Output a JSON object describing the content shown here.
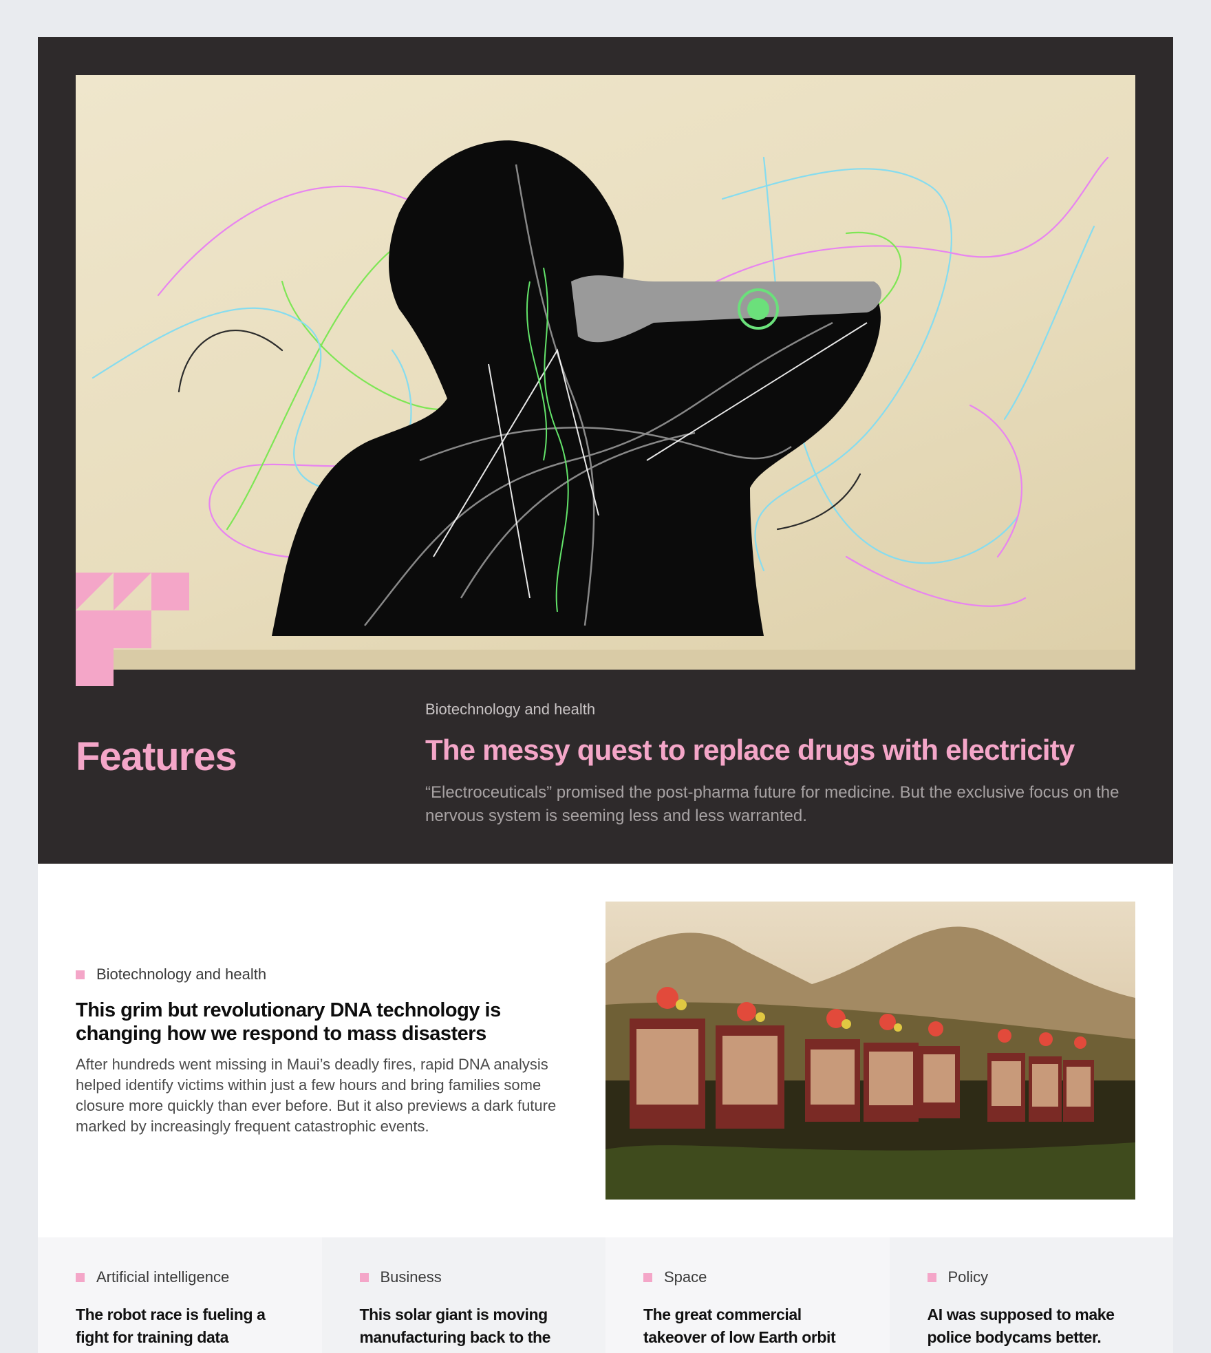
{
  "colors": {
    "accent_pink": "#f4a6c8",
    "hero_bg": "#2e2a2b",
    "page_bg": "#e9ebef"
  },
  "hero": {
    "section_title": "Features",
    "kicker": "Biotechnology and health",
    "headline": "The messy quest to replace drugs with electricity",
    "dek": "“Electroceuticals” promised the post-pharma future for medicine. But the exclusive focus on the nervous system is seeming less and less warranted.",
    "image_icon": "silhouette-illustration",
    "logo_icon": "pink-block-logo"
  },
  "story2": {
    "category": "Biotechnology and health",
    "headline": "This grim but revolutionary DNA technology is changing how we respond to mass disasters",
    "dek": "After hundreds went missing in Maui’s deadly fires, rapid DNA analysis helped identify victims within just a few hours and bring families some closure more quickly than ever before. But it also previews a dark future marked by increasingly frequent catastrophic events.",
    "image_icon": "memorial-photo"
  },
  "cards": [
    {
      "category": "Artificial intelligence",
      "headline": "The robot race is fueling a fight for training data"
    },
    {
      "category": "Business",
      "headline": "This solar giant is moving manufacturing back to the"
    },
    {
      "category": "Space",
      "headline": "The great commercial takeover of low Earth orbit"
    },
    {
      "category": "Policy",
      "headline": "AI was supposed to make police bodycams better."
    }
  ]
}
